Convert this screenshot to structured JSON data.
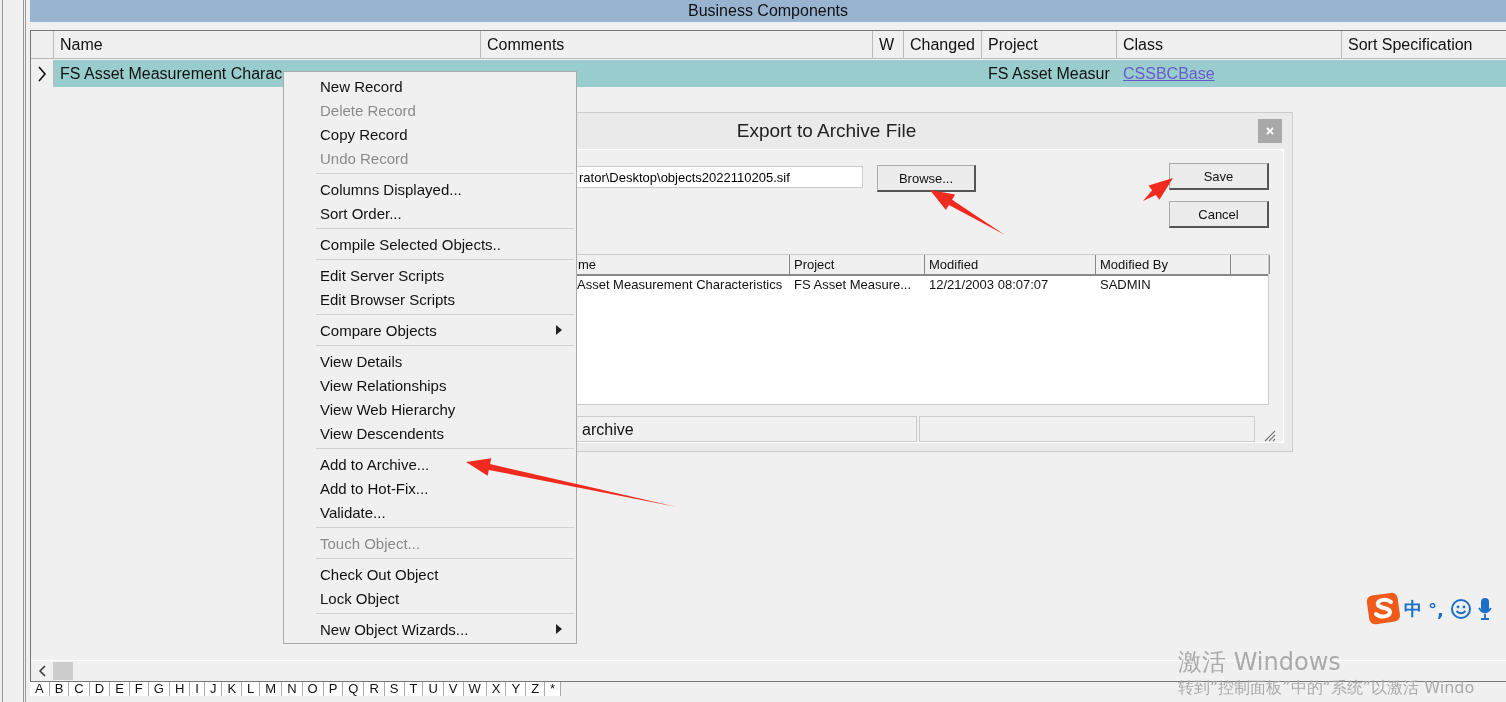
{
  "window": {
    "title": "Business Components"
  },
  "grid": {
    "columns": [
      "Name",
      "Comments",
      "W",
      "Changed",
      "Project",
      "Class",
      "Sort Specification"
    ],
    "rows": [
      {
        "selected": true,
        "name": "FS Asset Measurement Charac",
        "project": "FS Asset Measur",
        "class_link": "CSSBCBase"
      }
    ]
  },
  "alphabet": [
    "A",
    "B",
    "C",
    "D",
    "E",
    "F",
    "G",
    "H",
    "I",
    "J",
    "K",
    "L",
    "M",
    "N",
    "O",
    "P",
    "Q",
    "R",
    "S",
    "T",
    "U",
    "V",
    "W",
    "X",
    "Y",
    "Z",
    "*"
  ],
  "context_menu": {
    "groups": [
      [
        {
          "label": "New Record",
          "disabled": false,
          "submenu": false
        },
        {
          "label": "Delete Record",
          "disabled": true,
          "submenu": false
        },
        {
          "label": "Copy Record",
          "disabled": false,
          "submenu": false
        },
        {
          "label": "Undo Record",
          "disabled": true,
          "submenu": false
        }
      ],
      [
        {
          "label": "Columns Displayed...",
          "disabled": false,
          "submenu": false
        },
        {
          "label": "Sort Order...",
          "disabled": false,
          "submenu": false
        }
      ],
      [
        {
          "label": "Compile Selected Objects..",
          "disabled": false,
          "submenu": false
        }
      ],
      [
        {
          "label": "Edit Server Scripts",
          "disabled": false,
          "submenu": false
        },
        {
          "label": "Edit Browser Scripts",
          "disabled": false,
          "submenu": false
        }
      ],
      [
        {
          "label": "Compare Objects",
          "disabled": false,
          "submenu": true
        }
      ],
      [
        {
          "label": "View Details",
          "disabled": false,
          "submenu": false
        },
        {
          "label": "View Relationships",
          "disabled": false,
          "submenu": false
        },
        {
          "label": "View Web Hierarchy",
          "disabled": false,
          "submenu": false
        },
        {
          "label": "View Descendents",
          "disabled": false,
          "submenu": false
        }
      ],
      [
        {
          "label": "Add to Archive...",
          "disabled": false,
          "submenu": false
        },
        {
          "label": "Add to Hot-Fix...",
          "disabled": false,
          "submenu": false
        },
        {
          "label": "Validate...",
          "disabled": false,
          "submenu": false
        }
      ],
      [
        {
          "label": "Touch Object...",
          "disabled": true,
          "submenu": false
        }
      ],
      [
        {
          "label": "Check Out Object",
          "disabled": false,
          "submenu": false
        },
        {
          "label": "Lock Object",
          "disabled": false,
          "submenu": false
        }
      ],
      [
        {
          "label": "New Object Wizards...",
          "disabled": false,
          "submenu": true
        }
      ]
    ]
  },
  "dialog": {
    "title": "Export to Archive File",
    "file_path": "rator\\Desktop\\objects2022110205.sif",
    "browse_button": "Browse...",
    "save_button": "Save",
    "cancel_button": "Cancel",
    "list": {
      "columns": [
        "me",
        "Project",
        "Modified",
        "Modified By"
      ],
      "rows": [
        [
          "Asset Measurement Characteristics",
          "FS Asset Measure...",
          "12/21/2003 08:07:07",
          "SADMIN"
        ]
      ]
    },
    "status": "archive"
  },
  "ime_toolbar": {
    "mode": "中",
    "punctuation": "°,"
  },
  "activation_notice": {
    "title": "激活 Windows",
    "text": "转到“控制面板”中的“系统”以激活 Windo"
  }
}
